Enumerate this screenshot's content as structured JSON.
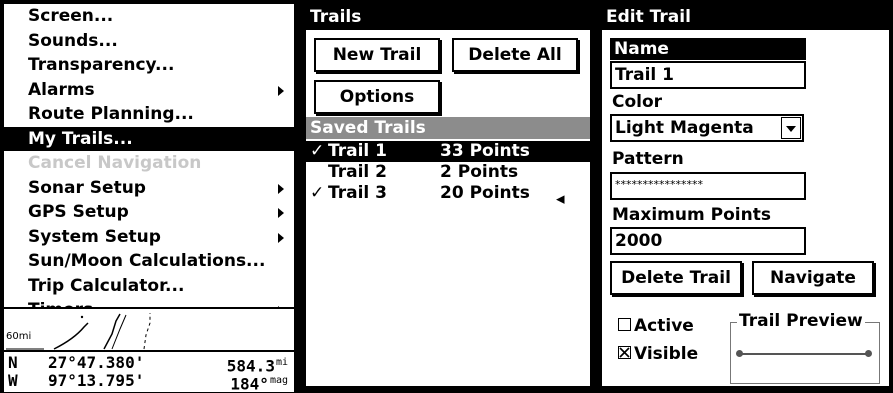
{
  "menu": {
    "items": [
      {
        "label": "Screen...",
        "submenu": false,
        "state": "normal"
      },
      {
        "label": "Sounds...",
        "submenu": false,
        "state": "normal"
      },
      {
        "label": "Transparency...",
        "submenu": false,
        "state": "normal"
      },
      {
        "label": "Alarms",
        "submenu": true,
        "state": "normal"
      },
      {
        "label": "Route Planning...",
        "submenu": false,
        "state": "normal"
      },
      {
        "label": "My Trails...",
        "submenu": false,
        "state": "selected"
      },
      {
        "label": "Cancel Navigation",
        "submenu": false,
        "state": "disabled"
      },
      {
        "label": "Sonar Setup",
        "submenu": true,
        "state": "normal"
      },
      {
        "label": "GPS Setup",
        "submenu": true,
        "state": "normal"
      },
      {
        "label": "System Setup",
        "submenu": true,
        "state": "normal"
      },
      {
        "label": "Sun/Moon Calculations...",
        "submenu": false,
        "state": "normal"
      },
      {
        "label": "Trip Calculator...",
        "submenu": false,
        "state": "normal"
      },
      {
        "label": "Timers",
        "submenu": true,
        "state": "normal"
      }
    ],
    "map_scale": "60mi",
    "position": {
      "lat_hemi": "N",
      "lat": "27°47.380'",
      "distance": "584.3",
      "distance_unit": "mi",
      "lon_hemi": "W",
      "lon": "97°13.795'",
      "heading": "184°",
      "heading_unit": "mag"
    }
  },
  "trails": {
    "title": "Trails",
    "new_trail_label": "New Trail",
    "delete_all_label": "Delete All",
    "options_label": "Options",
    "saved_header": "Saved Trails",
    "rows": [
      {
        "check": "✓",
        "name": "Trail 1",
        "points": "33 Points",
        "selected": true,
        "arrow": ""
      },
      {
        "check": "",
        "name": "Trail 2",
        "points": "2 Points",
        "selected": false,
        "arrow": ""
      },
      {
        "check": "✓",
        "name": "Trail 3",
        "points": "20 Points",
        "selected": false,
        "arrow": "◂"
      }
    ]
  },
  "edit": {
    "title": "Edit Trail",
    "name_label": "Name",
    "name_value": "Trail 1",
    "color_label": "Color",
    "color_value": "Light Magenta",
    "pattern_label": "Pattern",
    "pattern_value": "****************",
    "max_points_label": "Maximum Points",
    "max_points_value": "2000",
    "delete_label": "Delete Trail",
    "navigate_label": "Navigate",
    "active_label": "Active",
    "active_checked": false,
    "visible_label": "Visible",
    "visible_checked": true,
    "preview_title": "Trail Preview"
  }
}
